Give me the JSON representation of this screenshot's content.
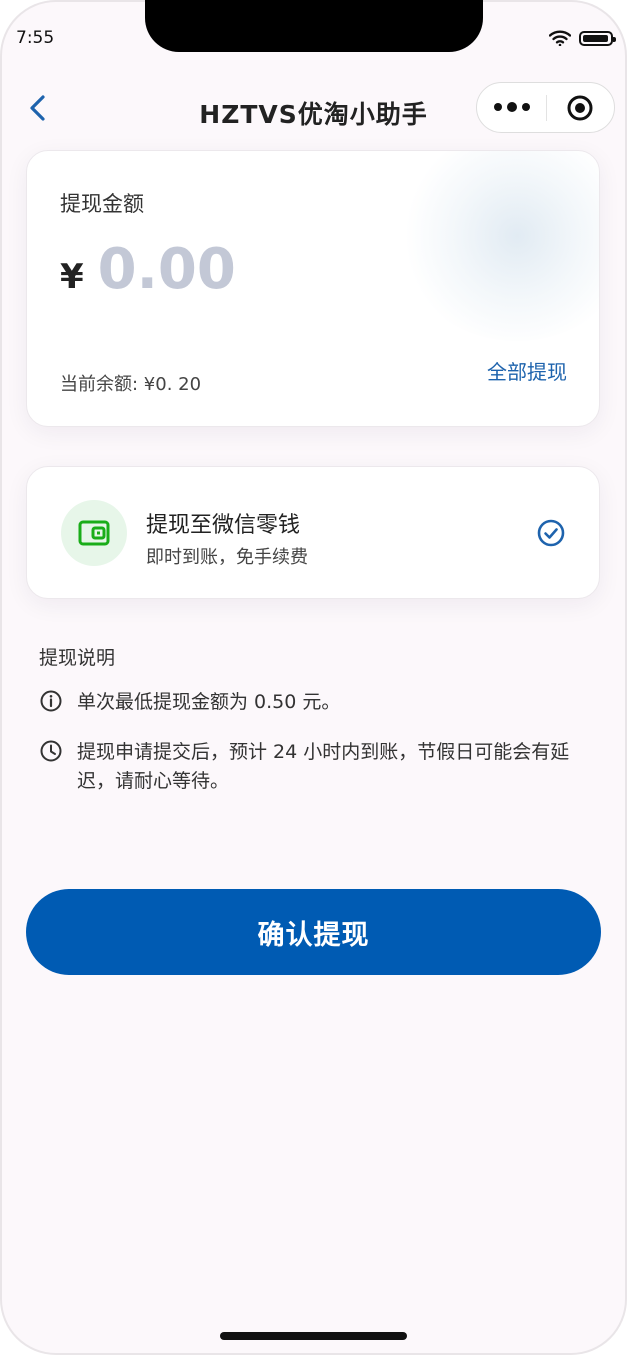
{
  "status": {
    "time": "7:55"
  },
  "nav": {
    "title": "HZTVS优淘小助手"
  },
  "amount": {
    "label": "提现金额",
    "currency": "¥",
    "placeholder": "0.00",
    "balance_text": "当前余额: ¥0. 20",
    "withdraw_all": "全部提现"
  },
  "method": {
    "title": "提现至微信零钱",
    "subtitle": "即时到账，免手续费",
    "icon": "wallet-icon",
    "selected": true
  },
  "notes": {
    "title": "提现说明",
    "items": [
      {
        "icon": "info-icon",
        "text": "单次最低提现金额为 0.50 元。"
      },
      {
        "icon": "clock-icon",
        "text": "提现申请提交后，预计 24 小时内到账，节假日可能会有延迟，请耐心等待。"
      }
    ]
  },
  "confirm_button": "确认提现",
  "colors": {
    "primary": "#005bb3",
    "link": "#1e63ad",
    "wechat_green": "#1aad19",
    "placeholder": "#c3c8d6"
  }
}
